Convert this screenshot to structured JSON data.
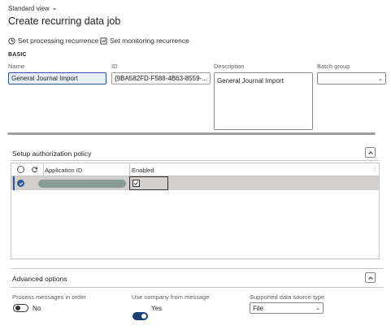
{
  "header": {
    "view_label": "Standard view",
    "title": "Create recurring data job"
  },
  "actions": {
    "processing": "Set processing recurrence",
    "monitoring": "Set monitoring recurrence"
  },
  "basic": {
    "group_label": "BASIC",
    "name_label": "Name",
    "name_value": "General Journal Import",
    "id_label": "ID",
    "id_value": "{9BA582FD-F588-4B63-8559-...",
    "description_label": "Description",
    "description_value": "General Journal Import",
    "batch_label": "Batch group",
    "batch_value": ""
  },
  "auth": {
    "title": "Setup authorization policy",
    "columns": [
      "Application ID",
      "Enabled"
    ],
    "rows": [
      {
        "selected": true,
        "application_id": "",
        "enabled": true
      }
    ]
  },
  "advanced": {
    "title": "Advanced options",
    "process_label": "Process messages in order",
    "process_value": "No",
    "process_on": false,
    "company_label": "Use company from message",
    "company_value": "Yes",
    "company_on": true,
    "source_label": "Supported data source type",
    "source_value": "File"
  },
  "colors": {
    "accent": "#2b579a",
    "toggle_on": "#1b3f73",
    "row_selected": "#d2d0ce"
  }
}
